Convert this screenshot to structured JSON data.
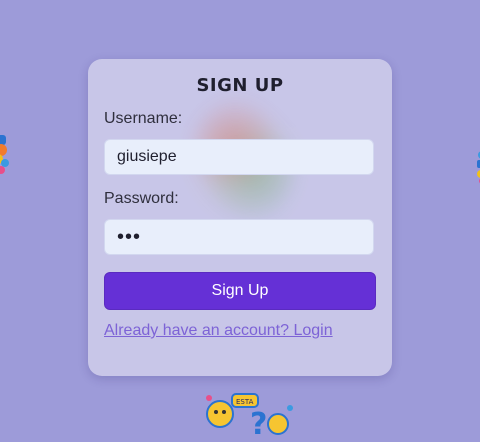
{
  "signup": {
    "title": "Sign Up",
    "username_label": "Username:",
    "username_value": "giusiepe",
    "password_label": "Password:",
    "password_value": "•••",
    "submit_label": "Sign Up",
    "login_link": "Already have an account? Login"
  },
  "colors": {
    "page_background": "#9d9bd9",
    "card_background": "#c8c6e8",
    "input_background": "#e8eefb",
    "button_background": "#6530d6",
    "link": "#7d63d6"
  },
  "decorations": {
    "left_sticker_icon": "sticker-icon",
    "right_sticker_icon": "sticker-icon",
    "bottom_sticker_icon": "sticker-icon"
  }
}
